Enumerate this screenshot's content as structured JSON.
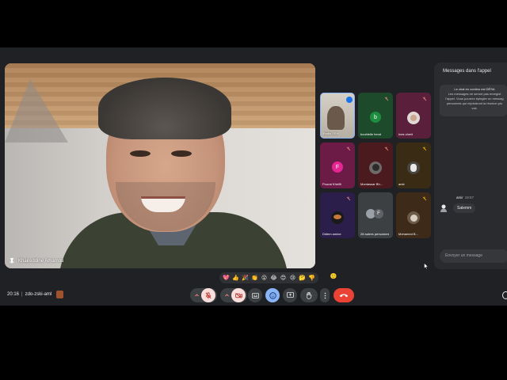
{
  "main_speaker": {
    "name": "Khaireddine Amamou"
  },
  "participants": [
    {
      "name": "Badis SEH",
      "kind": "video",
      "mic": "speaking"
    },
    {
      "name": "bouhlelle hend",
      "kind": "avatar",
      "initial": "b",
      "color": "#1e8e3e",
      "tile_bg": "#1e4a2c",
      "mic": "muted"
    },
    {
      "name": "Ines cherif",
      "kind": "photo",
      "tile_bg": "#5a1f3a",
      "mic": "muted"
    },
    {
      "name": "Pourat Khelifi",
      "kind": "avatar",
      "initial": "F",
      "color": "#e52592",
      "tile_bg": "#6b1b45",
      "mic": "muted"
    },
    {
      "name": "Montassar Bh...",
      "kind": "photo",
      "tile_bg": "#4a1a1e",
      "mic": "muted"
    },
    {
      "name": "amir",
      "kind": "photo",
      "tile_bg": "#3a2b14",
      "mic": "muted"
    },
    {
      "name": "Didem amine",
      "kind": "photo",
      "tile_bg": "#2c1e4a",
      "mic": "muted"
    },
    {
      "name": "28 autres personnes",
      "kind": "others",
      "initial": "F",
      "tile_bg": "#3c4043",
      "mic": "none"
    },
    {
      "name": "Mohamed B...",
      "kind": "photo",
      "tile_bg": "#3d2a18",
      "mic": "muted"
    }
  ],
  "chat": {
    "title": "Messages dans l'appel",
    "info_line1": "Le chat en continu est DÉSA",
    "info_rest": "Les messages ne seront pas enregist l'appel. Vous pourrez épingler un messag personnes qui rejoindront la réunion plu voir.",
    "message": {
      "author": "amir",
      "time": "19:57",
      "text": "Salemm"
    },
    "input_placeholder": "Envoyer un message"
  },
  "reactions": [
    "💖",
    "👍",
    "🎉",
    "👏",
    "😮",
    "😂",
    "😊",
    "😢",
    "🤔",
    "👎"
  ],
  "reaction_extra": "🙂",
  "meeting": {
    "time": "20:16",
    "separator": "|",
    "code": "zdo-zski-aml"
  },
  "colors": {
    "stage_bg": "#202124",
    "danger": "#ea4335",
    "muted_bg": "#f9dedc",
    "accent": "#8ab4f8",
    "ctrl_bg": "#3c4043"
  }
}
